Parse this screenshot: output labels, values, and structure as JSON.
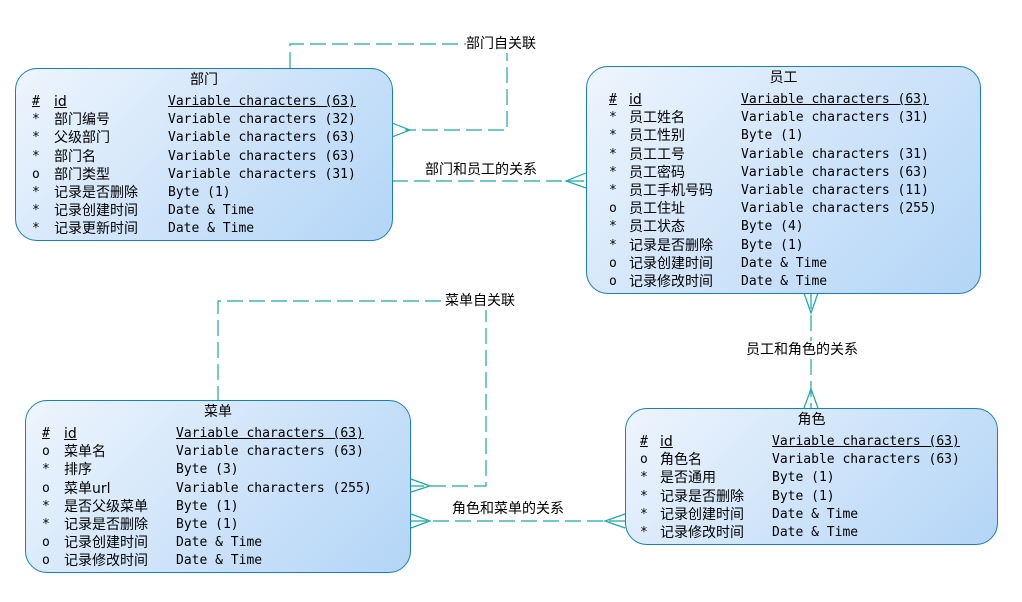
{
  "colors": {
    "entity_border": "#1a7fb8",
    "relationship_line": "#1aa7a7",
    "entity_fill_light": "#eef5fd",
    "entity_fill_dark": "#b3d5f7"
  },
  "entities": {
    "department": {
      "title": "部门",
      "columns": [
        {
          "mark": "#",
          "name": "id",
          "type": "Variable characters (63)",
          "pk": true
        },
        {
          "mark": "*",
          "name": "部门编号",
          "type": "Variable characters (32)"
        },
        {
          "mark": "*",
          "name": "父级部门",
          "type": "Variable characters (63)"
        },
        {
          "mark": "*",
          "name": "部门名",
          "type": "Variable characters (63)"
        },
        {
          "mark": "o",
          "name": "部门类型",
          "type": "Variable characters (31)"
        },
        {
          "mark": "*",
          "name": "记录是否删除",
          "type": "Byte (1)"
        },
        {
          "mark": "*",
          "name": "记录创建时间",
          "type": "Date & Time"
        },
        {
          "mark": "*",
          "name": "记录更新时间",
          "type": "Date & Time"
        }
      ]
    },
    "employee": {
      "title": "员工",
      "columns": [
        {
          "mark": "#",
          "name": "id",
          "type": "Variable characters (63)",
          "pk": true
        },
        {
          "mark": "*",
          "name": "员工姓名",
          "type": "Variable characters (31)"
        },
        {
          "mark": "*",
          "name": "员工性别",
          "type": "Byte (1)"
        },
        {
          "mark": "*",
          "name": "员工工号",
          "type": "Variable characters (31)"
        },
        {
          "mark": "*",
          "name": "员工密码",
          "type": "Variable characters (63)"
        },
        {
          "mark": "*",
          "name": "员工手机号码",
          "type": "Variable characters (11)"
        },
        {
          "mark": "o",
          "name": "员工住址",
          "type": "Variable characters (255)"
        },
        {
          "mark": "*",
          "name": "员工状态",
          "type": "Byte (4)"
        },
        {
          "mark": "*",
          "name": "记录是否删除",
          "type": "Byte (1)"
        },
        {
          "mark": "o",
          "name": "记录创建时间",
          "type": "Date & Time"
        },
        {
          "mark": "o",
          "name": "记录修改时间",
          "type": "Date & Time"
        }
      ]
    },
    "menu": {
      "title": "菜单",
      "columns": [
        {
          "mark": "#",
          "name": "id",
          "type": "Variable characters (63)",
          "pk": true
        },
        {
          "mark": "o",
          "name": "菜单名",
          "type": "Variable characters (63)"
        },
        {
          "mark": "*",
          "name": "排序",
          "type": "Byte (3)"
        },
        {
          "mark": "o",
          "name": "菜单url",
          "type": "Variable characters (255)"
        },
        {
          "mark": "*",
          "name": "是否父级菜单",
          "type": "Byte (1)"
        },
        {
          "mark": "*",
          "name": "记录是否删除",
          "type": "Byte (1)"
        },
        {
          "mark": "o",
          "name": "记录创建时间",
          "type": "Date & Time"
        },
        {
          "mark": "o",
          "name": "记录修改时间",
          "type": "Date & Time"
        }
      ]
    },
    "role": {
      "title": "角色",
      "columns": [
        {
          "mark": "#",
          "name": "id",
          "type": "Variable characters (63)",
          "pk": true
        },
        {
          "mark": "o",
          "name": "角色名",
          "type": "Variable characters (63)"
        },
        {
          "mark": "*",
          "name": "是否通用",
          "type": "Byte (1)"
        },
        {
          "mark": "*",
          "name": "记录是否删除",
          "type": "Byte (1)"
        },
        {
          "mark": "*",
          "name": "记录创建时间",
          "type": "Date & Time"
        },
        {
          "mark": "*",
          "name": "记录修改时间",
          "type": "Date & Time"
        }
      ]
    }
  },
  "relationships": {
    "dept_self": "部门自关联",
    "dept_employee": "部门和员工的关系",
    "menu_self": "菜单自关联",
    "employee_role": "员工和角色的关系",
    "role_menu": "角色和菜单的关系"
  }
}
